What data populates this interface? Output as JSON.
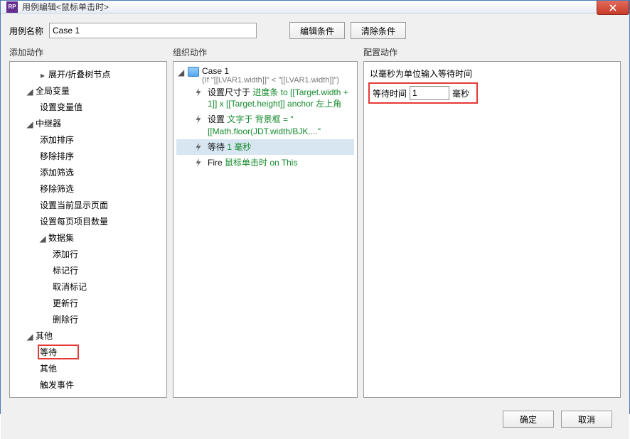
{
  "window": {
    "title": "用例编辑<鼠标单击时>"
  },
  "top": {
    "case_label": "用例名称",
    "case_value": "Case 1",
    "btn_edit_cond": "编辑条件",
    "btn_clear_cond": "清除条件"
  },
  "columns": {
    "add_action": "添加动作",
    "org_action": "组织动作",
    "cfg_action": "配置动作"
  },
  "tree": {
    "expand_collapse": "展开/折叠树节点",
    "global_vars": "全局变量",
    "set_var": "设置变量值",
    "repeater": "中继器",
    "add_sort": "添加排序",
    "remove_sort": "移除排序",
    "add_filter": "添加筛选",
    "remove_filter": "移除筛选",
    "set_current_page": "设置当前显示页面",
    "set_items_per_page": "设置每页项目数量",
    "dataset": "数据集",
    "add_row": "添加行",
    "mark_row": "标记行",
    "unmark_row": "取消标记",
    "update_row": "更新行",
    "delete_row": "删除行",
    "other_cat": "其他",
    "wait": "等待",
    "other": "其他",
    "fire_event": "触发事件"
  },
  "case_tree": {
    "case_name": "Case 1",
    "case_cond": "(If \"[[LVAR1.width]]\" < \"[[LVAR1.width]]\")",
    "a1_lbl": "设置尺寸于 ",
    "a1_grn": "进度条 to [[Target.width + 1]] x [[Target.height]] anchor 左上角",
    "a2_lbl": "设置 ",
    "a2_grn": "文字于 背景框 = \"[[Math.floor(JDT.width/BJK....\"",
    "a3_lbl": "等待 ",
    "a3_grn": "1 毫秒",
    "a4_lbl": "Fire ",
    "a4_grn": "鼠标单击时 on This"
  },
  "config": {
    "desc": "以毫秒为单位输入等待时间",
    "wait_label": "等待时间",
    "wait_value": "1",
    "wait_unit": "毫秒"
  },
  "footer": {
    "ok": "确定",
    "cancel": "取消"
  }
}
